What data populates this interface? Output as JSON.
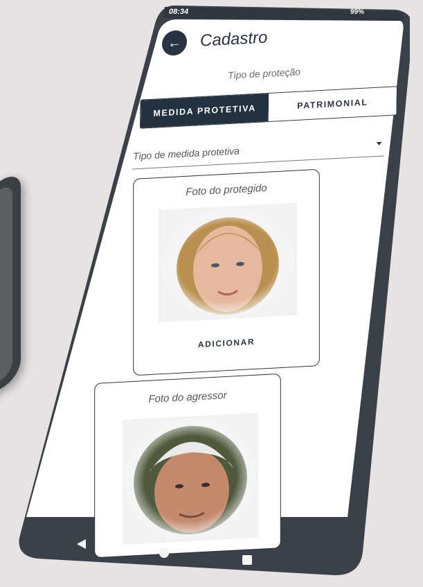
{
  "status_bar": {
    "time": "08:34",
    "battery": "99%"
  },
  "header": {
    "title": "Cadastro",
    "back_icon": "arrow-left-icon"
  },
  "protection": {
    "label": "Tipo de proteção",
    "options": [
      {
        "label": "MEDIDA PROTETIVA",
        "selected": true
      },
      {
        "label": "PATRIMONIAL",
        "selected": false
      }
    ]
  },
  "measure_select": {
    "label": "Tipo de medida protetiva"
  },
  "cards": [
    {
      "title": "Foto do protegido",
      "action": "ADICIONAR"
    },
    {
      "title": "Foto do agressor"
    }
  ],
  "nav": {
    "back": "back-triangle-icon",
    "home": "home-circle-icon",
    "recents": "recents-square-icon"
  },
  "colors": {
    "accent": "#243141",
    "background": "#e6e3e2",
    "frame": "#3a4148"
  }
}
